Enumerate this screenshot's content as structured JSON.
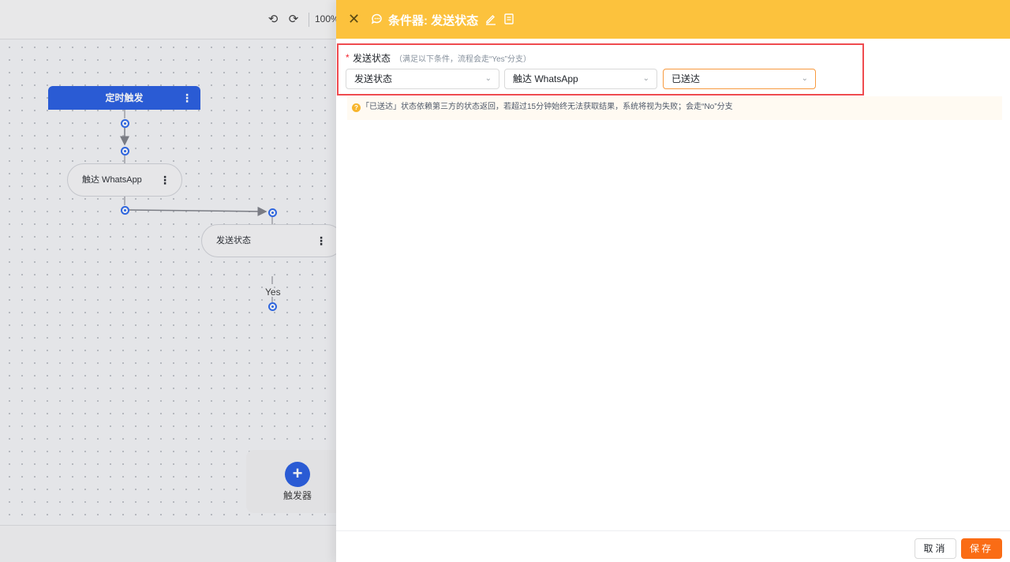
{
  "toolbar": {
    "undo_icon": "undo-icon",
    "redo_icon": "redo-icon",
    "zoom": "100%"
  },
  "canvas": {
    "trigger_node": {
      "label": "定时触发"
    },
    "whatsapp_node": {
      "label": "触达 WhatsApp"
    },
    "status_node": {
      "label": "发送状态"
    },
    "yes_label": "Yes",
    "add_trigger": {
      "label": "触发器"
    }
  },
  "drawer": {
    "title": "条件器: 发送状态",
    "field": {
      "required_mark": "*",
      "label": "发送状态",
      "hint": "（满足以下条件，流程会走“Yes”分支）"
    },
    "selects": [
      {
        "value": "发送状态"
      },
      {
        "value": "触达 WhatsApp"
      },
      {
        "value": "已送达"
      }
    ],
    "notice": "「已送达」状态依赖第三方的状态返回，若超过15分钟始终无法获取结果，系统将视为失败；会走“No”分支",
    "footer": {
      "cancel": "取消",
      "save": "保存"
    }
  },
  "colors": {
    "header": "#fcc23d",
    "primary": "#1f57e0",
    "save": "#fa6c15",
    "highlight": "#ef4b4f"
  }
}
